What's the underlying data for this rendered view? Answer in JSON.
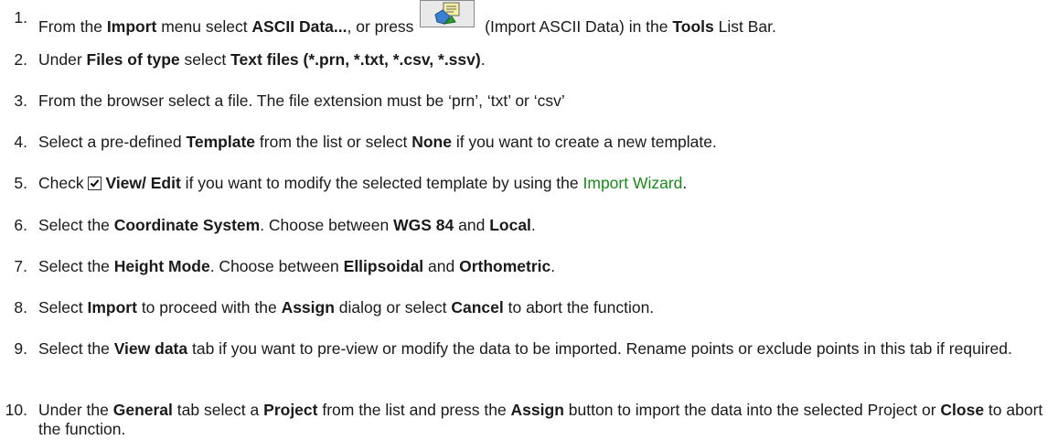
{
  "steps": [
    {
      "num": "1.",
      "segments": [
        {
          "t": "From the ",
          "s": "n"
        },
        {
          "t": "Import",
          "s": "b"
        },
        {
          "t": " menu select ",
          "s": "n"
        },
        {
          "t": "ASCII Data...",
          "s": "b"
        },
        {
          "t": ", or press ",
          "s": "n"
        },
        {
          "icon": "import-ascii-data-icon"
        },
        {
          "t": " (Import ASCII Data) in the ",
          "s": "n"
        },
        {
          "t": "Tools",
          "s": "b"
        },
        {
          "t": " List Bar.",
          "s": "n"
        }
      ]
    },
    {
      "num": "2.",
      "segments": [
        {
          "t": "Under ",
          "s": "n"
        },
        {
          "t": "Files of type",
          "s": "b"
        },
        {
          "t": " select ",
          "s": "n"
        },
        {
          "t": "Text files (*.prn, *.txt, *.csv, *.ssv)",
          "s": "b"
        },
        {
          "t": ".",
          "s": "n"
        }
      ]
    },
    {
      "num": "3.",
      "segments": [
        {
          "t": "From the browser select a file. The file extension must be ‘prn’, ‘txt’ or ‘csv’",
          "s": "n"
        }
      ]
    },
    {
      "num": "4.",
      "segments": [
        {
          "t": "Select a pre-defined ",
          "s": "n"
        },
        {
          "t": "Template",
          "s": "b"
        },
        {
          "t": " from the list or select ",
          "s": "n"
        },
        {
          "t": "None",
          "s": "b"
        },
        {
          "t": " if you want to create a new template.",
          "s": "n"
        }
      ]
    },
    {
      "num": "5.",
      "segments": [
        {
          "t": "Check ",
          "s": "n"
        },
        {
          "checkbox": "checked-checkbox-icon"
        },
        {
          "t": "View/ Edit",
          "s": "b"
        },
        {
          "t": " if you want to modify the selected template by using the ",
          "s": "n"
        },
        {
          "t": "Import Wizard",
          "s": "link"
        },
        {
          "t": ".",
          "s": "n"
        }
      ]
    },
    {
      "num": "6.",
      "segments": [
        {
          "t": "Select the ",
          "s": "n"
        },
        {
          "t": "Coordinate System",
          "s": "b"
        },
        {
          "t": ". Choose between ",
          "s": "n"
        },
        {
          "t": "WGS 84",
          "s": "b"
        },
        {
          "t": " and ",
          "s": "n"
        },
        {
          "t": "Local",
          "s": "b"
        },
        {
          "t": ".",
          "s": "n"
        }
      ]
    },
    {
      "num": "7.",
      "segments": [
        {
          "t": "Select the ",
          "s": "n"
        },
        {
          "t": "Height Mode",
          "s": "b"
        },
        {
          "t": ". Choose between ",
          "s": "n"
        },
        {
          "t": "Ellipsoidal",
          "s": "b"
        },
        {
          "t": " and ",
          "s": "n"
        },
        {
          "t": "Orthometric",
          "s": "b"
        },
        {
          "t": ".",
          "s": "n"
        }
      ]
    },
    {
      "num": "8.",
      "segments": [
        {
          "t": "Select ",
          "s": "n"
        },
        {
          "t": "Import",
          "s": "b"
        },
        {
          "t": " to proceed with the ",
          "s": "n"
        },
        {
          "t": "Assign",
          "s": "b"
        },
        {
          "t": " dialog or select ",
          "s": "n"
        },
        {
          "t": "Cancel",
          "s": "b"
        },
        {
          "t": " to abort the function.",
          "s": "n"
        }
      ]
    },
    {
      "num": "9.",
      "segments": [
        {
          "t": "Select the ",
          "s": "n"
        },
        {
          "t": "View data",
          "s": "b"
        },
        {
          "t": " tab if you want to pre-view or modify the data to be imported. Rename points or exclude points in this tab if required.",
          "s": "n"
        }
      ]
    },
    {
      "num": "10.",
      "segments": [
        {
          "t": "Under the ",
          "s": "n"
        },
        {
          "t": "General",
          "s": "b"
        },
        {
          "t": " tab select a ",
          "s": "n"
        },
        {
          "t": "Project",
          "s": "b"
        },
        {
          "t": " from the list and press the ",
          "s": "n"
        },
        {
          "t": "Assign",
          "s": "b"
        },
        {
          "t": " button to import the data into the selected Project or ",
          "s": "n"
        },
        {
          "t": "Close",
          "s": "b"
        },
        {
          "t": " to abort the function.",
          "s": "n"
        }
      ]
    }
  ],
  "colors": {
    "text": "#1a1a1a",
    "link": "#1a8a1a"
  }
}
